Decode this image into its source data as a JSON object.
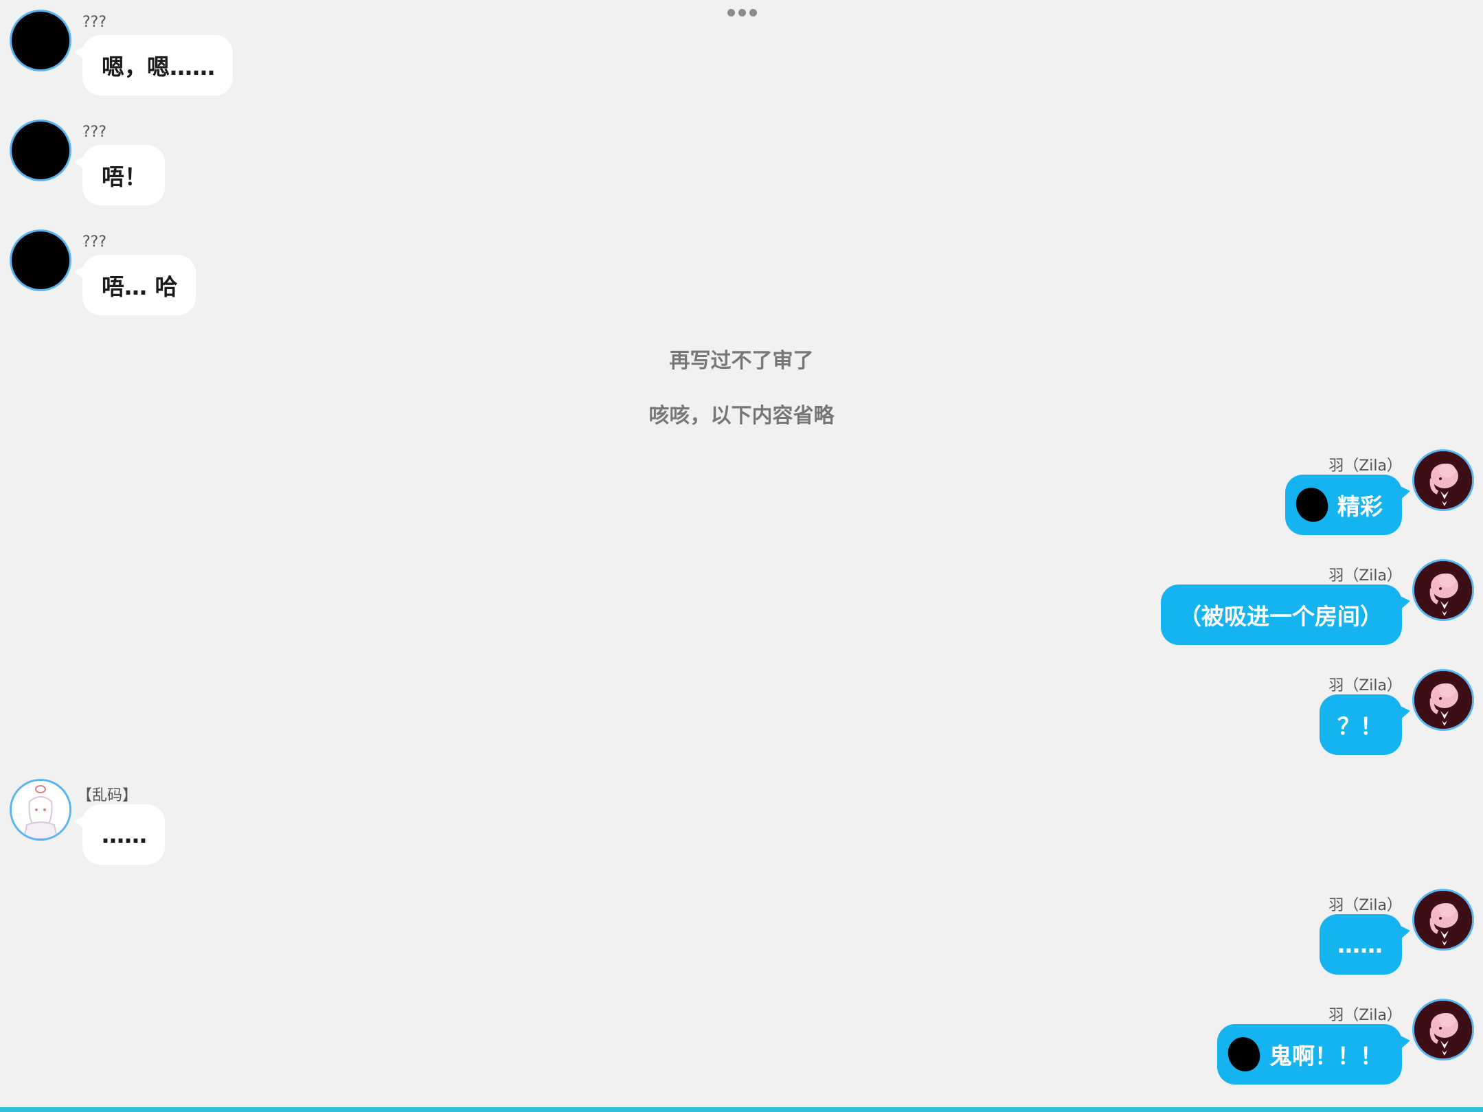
{
  "toolbar": {
    "more_icon": "more-horizontal-icon"
  },
  "messages": [
    {
      "sender": "???",
      "text": "嗯，嗯……"
    },
    {
      "sender": "???",
      "text": "唔！"
    },
    {
      "sender": "???",
      "text": "唔… 哈"
    },
    {
      "sender": "羽（Zila）",
      "text": "精彩"
    },
    {
      "sender": "羽（Zila）",
      "text": "（被吸进一个房间）"
    },
    {
      "sender": "羽（Zila）",
      "text": "？！"
    },
    {
      "sender": "【乱码】",
      "text": "……"
    },
    {
      "sender": "羽（Zila）",
      "text": "……"
    },
    {
      "sender": "羽（Zila）",
      "text": "鬼啊！！！"
    }
  ],
  "narration": [
    "再写过不了审了",
    "咳咳，以下内容省略"
  ],
  "colors": {
    "background": "#f1f1f1",
    "incoming_bubble": "#ffffff",
    "outgoing_bubble": "#15b4f0",
    "avatar_border": "#5ab4f2",
    "bottom_bar": "#2fc0d8"
  }
}
